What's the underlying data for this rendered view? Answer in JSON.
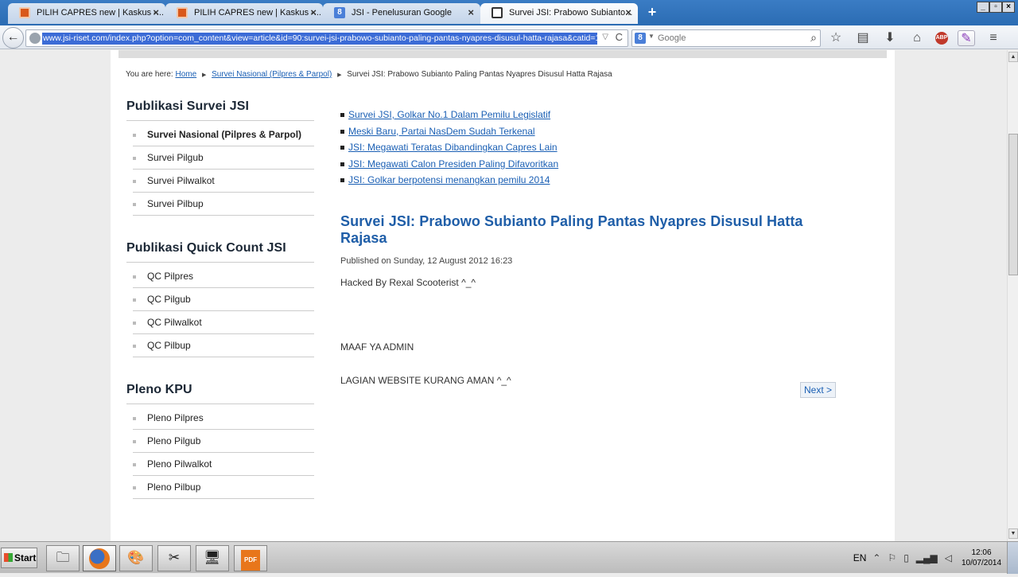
{
  "browser": {
    "tabs": [
      {
        "title": "PILIH CAPRES new | Kaskus -...",
        "icon": "kaskus-icon",
        "active": false
      },
      {
        "title": "PILIH CAPRES new | Kaskus -...",
        "icon": "kaskus-icon",
        "active": false
      },
      {
        "title": "JSI - Penelusuran Google",
        "icon": "google-icon",
        "active": false
      },
      {
        "title": "Survei JSI: Prabowo Subianto...",
        "icon": "jsi-icon",
        "active": true
      }
    ],
    "new_tab_label": "+",
    "url": "www.jsi-riset.com/index.php?option=com_content&view=article&id=90:survei-jsi-prabowo-subianto-paling-pantas-nyapres-disusul-hatta-rajasa&catid=17",
    "search_placeholder": "Google",
    "google_badge": "8",
    "abp_label": "ABP"
  },
  "breadcrumb": {
    "prefix": "You are here:",
    "home": "Home",
    "category": "Survei Nasional (Pilpres & Parpol)",
    "current": "Survei JSI: Prabowo Subianto Paling Pantas Nyapres Disusul Hatta Rajasa"
  },
  "sidebar": {
    "groups": [
      {
        "heading": "Publikasi Survei JSI",
        "items": [
          "Survei Nasional (Pilpres & Parpol)",
          "Survei Pilgub",
          "Survei Pilwalkot",
          "Survei Pilbup"
        ]
      },
      {
        "heading": "Publikasi Quick Count JSI",
        "items": [
          "QC Pilpres",
          "QC Pilgub",
          "QC Pilwalkot",
          "QC Pilbup"
        ]
      },
      {
        "heading": "Pleno KPU",
        "items": [
          "Pleno Pilpres",
          "Pleno Pilgub",
          "Pleno Pilwalkot",
          "Pleno Pilbup"
        ]
      }
    ]
  },
  "related": [
    "Survei JSI, Golkar No.1 Dalam Pemilu Legislatif",
    "Meski Baru, Partai NasDem Sudah Terkenal",
    "JSI: Megawati Teratas Dibandingkan Capres Lain",
    "JSI: Megawati Calon Presiden Paling Difavoritkan",
    "JSI: Golkar berpotensi menangkan pemilu 2014"
  ],
  "article": {
    "title": "Survei JSI: Prabowo Subianto Paling Pantas Nyapres Disusul Hatta Rajasa",
    "published": "Published on Sunday, 12 August 2012 16:23",
    "paragraphs": [
      "Hacked By Rexal Scooterist ^_^",
      "MAAF YA ADMIN",
      "LAGIAN WEBSITE  KURANG AMAN ^_^"
    ],
    "next_label": "Next >"
  },
  "taskbar": {
    "start_label": "Start",
    "pdf_label": "PDF",
    "language": "EN",
    "time": "12:06",
    "date": "10/07/2014"
  }
}
